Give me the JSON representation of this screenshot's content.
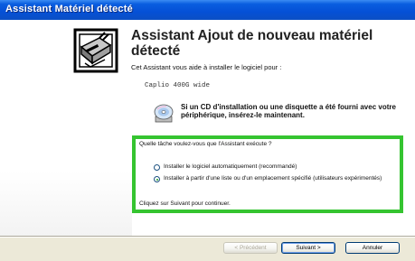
{
  "window": {
    "title": "Assistant Matériel détecté"
  },
  "wizard": {
    "heading": "Assistant Ajout de nouveau matériel détecté",
    "intro": "Cet Assistant vous aide à installer le logiciel pour :",
    "device_name": "Caplio 400G wide",
    "cd_instruction": "Si un CD d'installation ou une disquette a été fourni avec votre périphérique, insérez-le maintenant.",
    "question": "Quelle tâche voulez-vous que l'Assistant exécute ?",
    "options": [
      {
        "label": "Installer le logiciel automatiquement (recommandé)",
        "checked": false
      },
      {
        "label": "Installer à partir d'une liste ou d'un emplacement spécifié (utilisateurs expérimentés)",
        "checked": true
      }
    ],
    "continue_text": "Cliquez sur Suivant pour continuer."
  },
  "buttons": {
    "back": "< Précédent",
    "next": "Suivant >",
    "cancel": "Annuler"
  },
  "colors": {
    "title_bar": "#0a5ee0",
    "window_bg": "#ece9d8",
    "highlight": "#35c430"
  },
  "icons": {
    "wizard": "hardware-wizard-icon",
    "cd": "cd-disk-icon"
  }
}
